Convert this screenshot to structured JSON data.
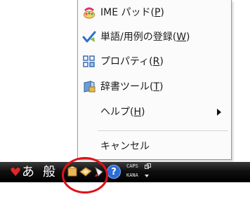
{
  "menu": {
    "items": [
      {
        "label": "IME パッド(",
        "key": "P",
        "suffix": ")",
        "icon": "ime-pad-icon"
      },
      {
        "label": "単語/用例の登録(",
        "key": "W",
        "suffix": ")",
        "icon": "word-register-icon"
      },
      {
        "label": "プロパティ(",
        "key": "R",
        "suffix": ")",
        "icon": "properties-icon"
      },
      {
        "label": "辞書ツール(",
        "key": "T",
        "suffix": ")",
        "icon": "dictionary-tool-icon"
      },
      {
        "label": "ヘルプ(",
        "key": "H",
        "suffix": ")",
        "icon": ""
      },
      {
        "label": "キャンセル",
        "key": "",
        "suffix": "",
        "icon": ""
      }
    ]
  },
  "taskbar": {
    "input_mode": "あ",
    "conversion_mode": "般",
    "caps": "CAPS",
    "kana": "KANA",
    "help_glyph": "?"
  },
  "colors": {
    "highlight_circle": "#e0101a",
    "menu_bg": "#fbfbfb",
    "taskbar_bg": "#000000"
  }
}
